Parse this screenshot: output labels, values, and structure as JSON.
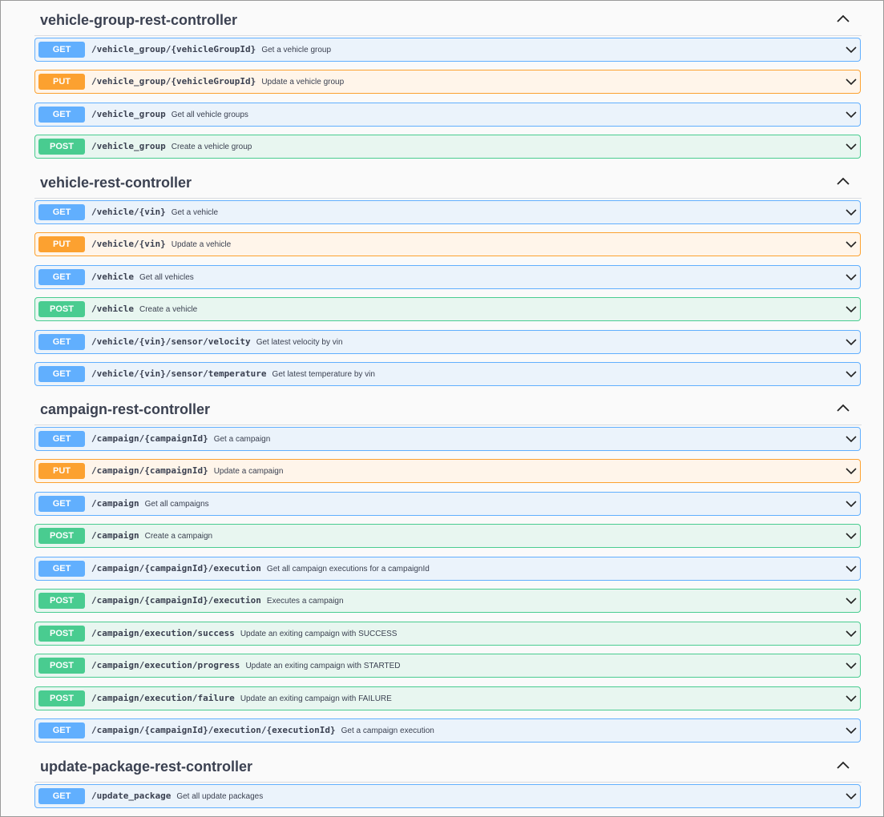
{
  "colors": {
    "get": "#61affe",
    "put": "#fca130",
    "post": "#49cc90",
    "get_bg": "#ebf3fb",
    "put_bg": "#fff5ea",
    "post_bg": "#e8f6f0"
  },
  "sections": [
    {
      "title": "vehicle-group-rest-controller",
      "expanded": true,
      "operations": [
        {
          "method": "GET",
          "path": "/vehicle_group/{vehicleGroupId}",
          "summary": "Get a vehicle group"
        },
        {
          "method": "PUT",
          "path": "/vehicle_group/{vehicleGroupId}",
          "summary": "Update a vehicle group"
        },
        {
          "method": "GET",
          "path": "/vehicle_group",
          "summary": "Get all vehicle groups"
        },
        {
          "method": "POST",
          "path": "/vehicle_group",
          "summary": "Create a vehicle group"
        }
      ]
    },
    {
      "title": "vehicle-rest-controller",
      "expanded": true,
      "operations": [
        {
          "method": "GET",
          "path": "/vehicle/{vin}",
          "summary": "Get a vehicle"
        },
        {
          "method": "PUT",
          "path": "/vehicle/{vin}",
          "summary": "Update a vehicle"
        },
        {
          "method": "GET",
          "path": "/vehicle",
          "summary": "Get all vehicles"
        },
        {
          "method": "POST",
          "path": "/vehicle",
          "summary": "Create a vehicle"
        },
        {
          "method": "GET",
          "path": "/vehicle/{vin}/sensor/velocity",
          "summary": "Get latest velocity by vin"
        },
        {
          "method": "GET",
          "path": "/vehicle/{vin}/sensor/temperature",
          "summary": "Get latest temperature by vin"
        }
      ]
    },
    {
      "title": "campaign-rest-controller",
      "expanded": true,
      "operations": [
        {
          "method": "GET",
          "path": "/campaign/{campaignId}",
          "summary": "Get a campaign"
        },
        {
          "method": "PUT",
          "path": "/campaign/{campaignId}",
          "summary": "Update a campaign"
        },
        {
          "method": "GET",
          "path": "/campaign",
          "summary": "Get all campaigns"
        },
        {
          "method": "POST",
          "path": "/campaign",
          "summary": "Create a campaign"
        },
        {
          "method": "GET",
          "path": "/campaign/{campaignId}/execution",
          "summary": "Get all campaign executions for a campaignId"
        },
        {
          "method": "POST",
          "path": "/campaign/{campaignId}/execution",
          "summary": "Executes a campaign"
        },
        {
          "method": "POST",
          "path": "/campaign/execution/success",
          "summary": "Update an exiting campaign with SUCCESS"
        },
        {
          "method": "POST",
          "path": "/campaign/execution/progress",
          "summary": "Update an exiting campaign with STARTED"
        },
        {
          "method": "POST",
          "path": "/campaign/execution/failure",
          "summary": "Update an exiting campaign with FAILURE"
        },
        {
          "method": "GET",
          "path": "/campaign/{campaignId}/execution/{executionId}",
          "summary": "Get a campaign execution"
        }
      ]
    },
    {
      "title": "update-package-rest-controller",
      "expanded": true,
      "operations": [
        {
          "method": "GET",
          "path": "/update_package",
          "summary": "Get all update packages"
        }
      ]
    }
  ]
}
